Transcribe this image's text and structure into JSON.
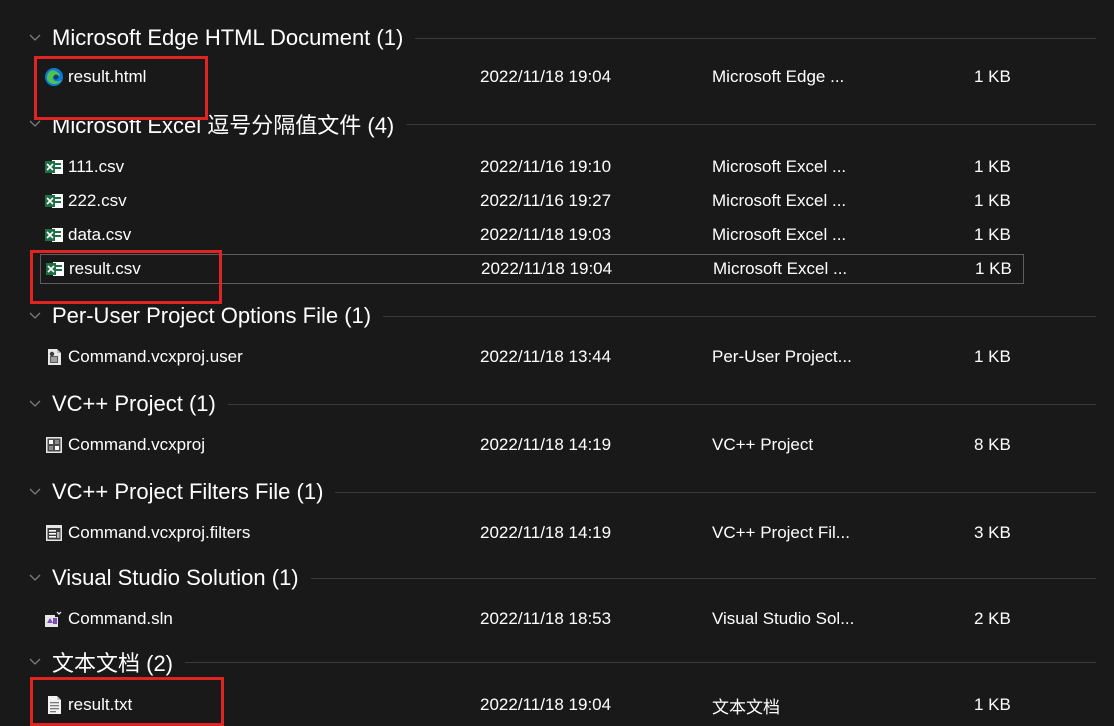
{
  "groups": [
    {
      "title": "Microsoft Edge HTML Document (1)",
      "files": [
        {
          "name": "result.html",
          "date": "2022/11/18 19:04",
          "type": "Microsoft Edge ...",
          "size": "1 KB",
          "icon": "edge-icon"
        }
      ]
    },
    {
      "title": "Microsoft Excel 逗号分隔值文件 (4)",
      "files": [
        {
          "name": "111.csv",
          "date": "2022/11/16 19:10",
          "type": "Microsoft Excel ...",
          "size": "1 KB",
          "icon": "excel-csv-icon"
        },
        {
          "name": "222.csv",
          "date": "2022/11/16 19:27",
          "type": "Microsoft Excel ...",
          "size": "1 KB",
          "icon": "excel-csv-icon"
        },
        {
          "name": "data.csv",
          "date": "2022/11/18 19:03",
          "type": "Microsoft Excel ...",
          "size": "1 KB",
          "icon": "excel-csv-icon"
        },
        {
          "name": "result.csv",
          "date": "2022/11/18 19:04",
          "type": "Microsoft Excel ...",
          "size": "1 KB",
          "icon": "excel-csv-icon",
          "selected": true
        }
      ]
    },
    {
      "title": "Per-User Project Options File (1)",
      "files": [
        {
          "name": "Command.vcxproj.user",
          "date": "2022/11/18 13:44",
          "type": "Per-User Project...",
          "size": "1 KB",
          "icon": "vs-user-file-icon"
        }
      ]
    },
    {
      "title": "VC++ Project (1)",
      "files": [
        {
          "name": "Command.vcxproj",
          "date": "2022/11/18 14:19",
          "type": "VC++ Project",
          "size": "8 KB",
          "icon": "vcxproj-icon"
        }
      ]
    },
    {
      "title": "VC++ Project Filters File (1)",
      "files": [
        {
          "name": "Command.vcxproj.filters",
          "date": "2022/11/18 14:19",
          "type": "VC++ Project Fil...",
          "size": "3 KB",
          "icon": "vcxproj-filters-icon"
        }
      ]
    },
    {
      "title": "Visual Studio Solution (1)",
      "files": [
        {
          "name": "Command.sln",
          "date": "2022/11/18 18:53",
          "type": "Visual Studio Sol...",
          "size": "2 KB",
          "icon": "vs-solution-icon"
        }
      ]
    },
    {
      "title": "文本文档 (2)",
      "files": [
        {
          "name": "result.txt",
          "date": "2022/11/18 19:04",
          "type": "文本文档",
          "size": "1 KB",
          "icon": "text-document-icon"
        }
      ]
    }
  ],
  "colors": {
    "background": "#191919",
    "text": "#ffffff",
    "highlight_box": "#e02424",
    "excel_green": "#1d7044",
    "edge_blue": "#0c7bd6",
    "edge_green": "#4fc257"
  }
}
